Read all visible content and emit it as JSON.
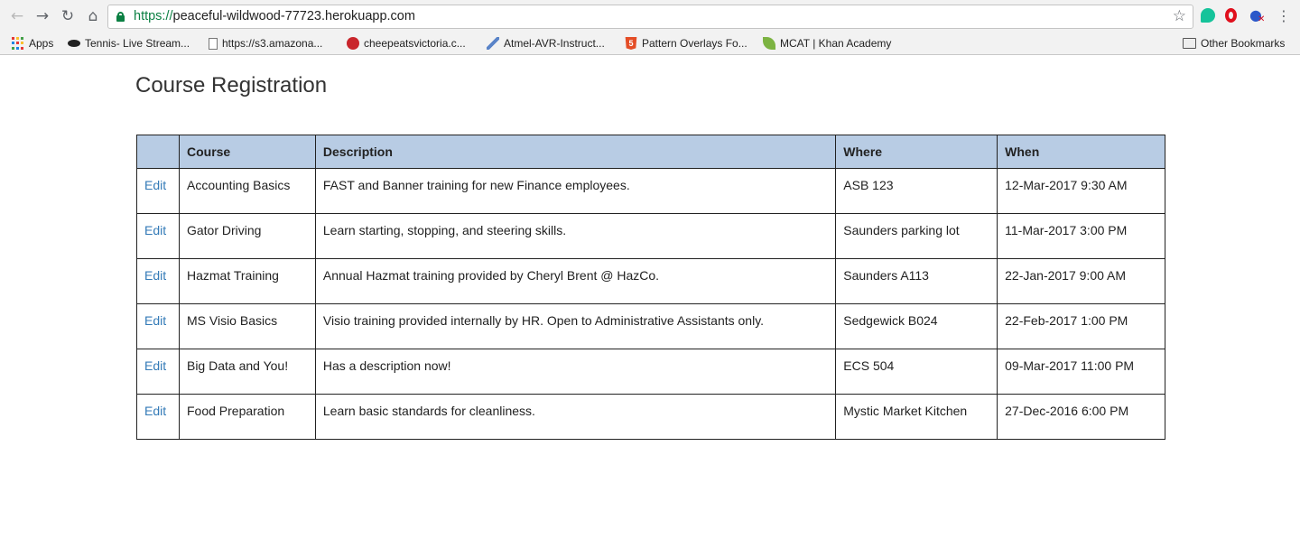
{
  "browser": {
    "url_scheme": "https://",
    "url_host": "peaceful-wildwood-77723.herokuapp.com",
    "bookmarks": [
      {
        "label": "Apps",
        "icon": "apps-grid-icon"
      },
      {
        "label": "Tennis- Live Stream...",
        "icon": "bat-icon"
      },
      {
        "label": "https://s3.amazona...",
        "icon": "page-icon"
      },
      {
        "label": "cheepeatsvictoria.c...",
        "icon": "crab-icon"
      },
      {
        "label": "Atmel-AVR-Instruct...",
        "icon": "pen-icon"
      },
      {
        "label": "Pattern Overlays Fo...",
        "icon": "html5-icon"
      },
      {
        "label": "MCAT | Khan Academy",
        "icon": "leaf-icon"
      }
    ],
    "other_bookmarks": "Other Bookmarks",
    "colors": {
      "secure": "#0b8043",
      "header_bg": "#b8cce4",
      "link": "#337ab7"
    }
  },
  "page": {
    "title": "Course Registration",
    "columns": [
      "",
      "Course",
      "Description",
      "Where",
      "When"
    ],
    "rows": [
      {
        "action": "Edit",
        "course": "Accounting Basics",
        "description": "FAST and Banner training for new Finance employees.",
        "where": "ASB 123",
        "when": "12-Mar-2017 9:30 AM"
      },
      {
        "action": "Edit",
        "course": "Gator Driving",
        "description": "Learn starting, stopping, and steering skills.",
        "where": "Saunders parking lot",
        "when": "11-Mar-2017 3:00 PM"
      },
      {
        "action": "Edit",
        "course": "Hazmat Training",
        "description": "Annual Hazmat training provided by Cheryl Brent @ HazCo.",
        "where": "Saunders A113",
        "when": "22-Jan-2017 9:00 AM"
      },
      {
        "action": "Edit",
        "course": "MS Visio Basics",
        "description": "Visio training provided internally by HR. Open to Administrative Assistants only.",
        "where": "Sedgewick B024",
        "when": "22-Feb-2017 1:00 PM"
      },
      {
        "action": "Edit",
        "course": "Big Data and You!",
        "description": "Has a description now!",
        "where": "ECS 504",
        "when": "09-Mar-2017 11:00 PM"
      },
      {
        "action": "Edit",
        "course": "Food Preparation",
        "description": "Learn basic standards for cleanliness.",
        "where": "Mystic Market Kitchen",
        "when": "27-Dec-2016 6:00 PM"
      }
    ]
  }
}
